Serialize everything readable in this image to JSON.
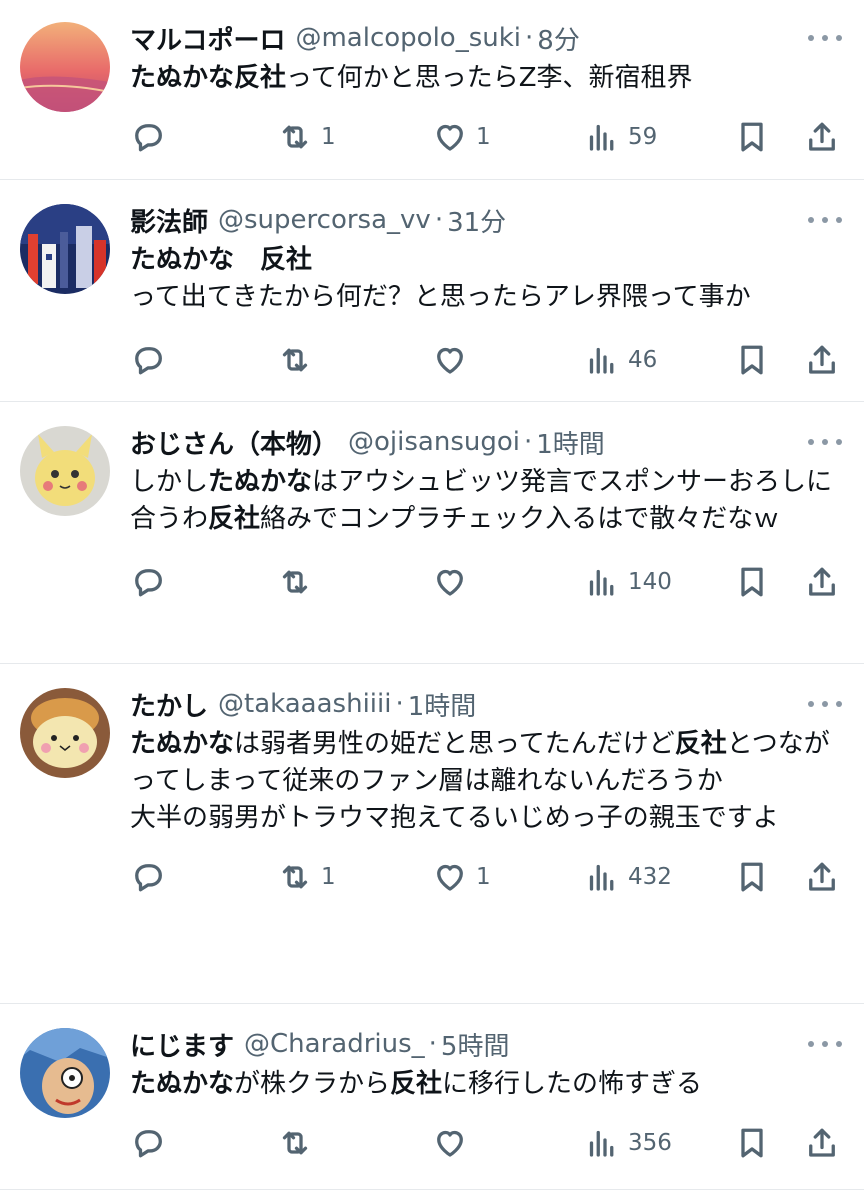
{
  "tweets": [
    {
      "name": "マルコポーロ",
      "handle": "@malcopolo_suki",
      "sep": "·",
      "time": "8分",
      "segments": [
        {
          "t": "たぬかな",
          "b": true
        },
        {
          "t": "反社",
          "b": true
        },
        {
          "t": "って何かと思ったらZ李、新宿租界",
          "b": false
        }
      ],
      "replies": "",
      "retweets": "1",
      "likes": "1",
      "views": "59",
      "avatar_colors": [
        "#f3a07a",
        "#c84b6e"
      ]
    },
    {
      "name": "影法師",
      "handle": "@supercorsa_vv",
      "sep": "·",
      "time": "31分",
      "segments": [
        {
          "t": "たぬかな　反社",
          "b": true
        },
        {
          "t": "\nって出てきたから何だ？と思ったらアレ界隈って事か",
          "b": false
        }
      ],
      "replies": "",
      "retweets": "",
      "likes": "",
      "views": "46",
      "avatar_colors": [
        "#1c2f6e",
        "#d6342a"
      ]
    },
    {
      "name": "おじさん（本物）",
      "handle": "@ojisansugoi",
      "sep": "·",
      "time": "1時間",
      "segments": [
        {
          "t": "しかし",
          "b": false
        },
        {
          "t": "たぬかな",
          "b": true
        },
        {
          "t": "はアウシュビッツ発言でスポンサーおろしに合うわ",
          "b": false
        },
        {
          "t": "反社",
          "b": true
        },
        {
          "t": "絡みでコンプラチェック入るはで散々だなｗ",
          "b": false
        }
      ],
      "replies": "",
      "retweets": "",
      "likes": "",
      "views": "140",
      "avatar_colors": [
        "#d8d8d0",
        "#f0dc78"
      ]
    },
    {
      "name": "たかし",
      "handle": "@takaaashiiii",
      "sep": "·",
      "time": "1時間",
      "segments": [
        {
          "t": "たぬかな",
          "b": true
        },
        {
          "t": "は弱者男性の姫だと思ってたんだけど",
          "b": false
        },
        {
          "t": "反社",
          "b": true
        },
        {
          "t": "とつながってしまって従来のファン層は離れないんだろうか\n大半の弱男がトラウマ抱えてるいじめっ子の親玉ですよ",
          "b": false
        }
      ],
      "replies": "",
      "retweets": "1",
      "likes": "1",
      "views": "432",
      "avatar_colors": [
        "#8a5a3a",
        "#f2e2a8"
      ]
    },
    {
      "name": "にじます",
      "handle": "@Charadrius_",
      "sep": "·",
      "time": "5時間",
      "segments": [
        {
          "t": "たぬかな",
          "b": true
        },
        {
          "t": "が株クラから",
          "b": false
        },
        {
          "t": "反社",
          "b": true
        },
        {
          "t": "に移行したの怖すぎる",
          "b": false
        }
      ],
      "replies": "",
      "retweets": "",
      "likes": "",
      "views": "356",
      "avatar_colors": [
        "#3a6fb0",
        "#e3b48a"
      ]
    }
  ],
  "colors": {
    "text": "#0f1419",
    "muted": "#536471",
    "border": "#e6e9ec"
  },
  "icons": {
    "reply": "reply-icon",
    "retweet": "retweet-icon",
    "like": "heart-icon",
    "views": "views-icon",
    "bookmark": "bookmark-icon",
    "share": "share-icon",
    "more": "more-icon"
  }
}
